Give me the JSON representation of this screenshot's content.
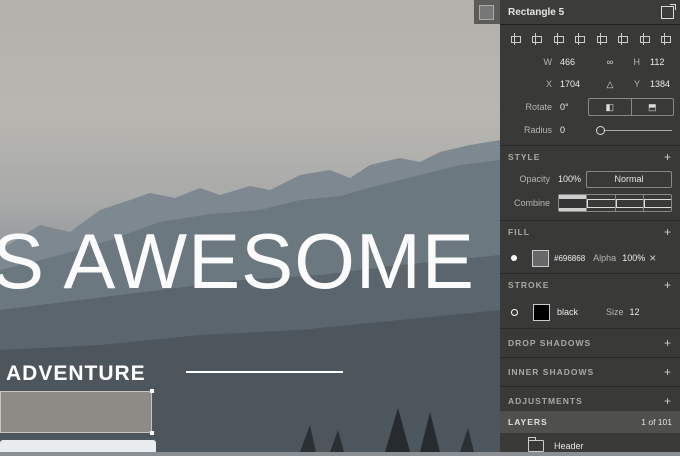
{
  "canvas": {
    "headline": "S AWESOME",
    "subheadline": "ADVENTURE"
  },
  "panel": {
    "title": "Rectangle 5",
    "w_label": "W",
    "w_value": "466",
    "h_label": "H",
    "h_value": "112",
    "x_label": "X",
    "x_value": "1704",
    "y_label": "Y",
    "y_value": "1384",
    "rotate_label": "Rotate",
    "rotate_value": "0°",
    "radius_label": "Radius",
    "radius_value": "0",
    "style_header": "STYLE",
    "opacity_label": "Opacity",
    "opacity_value": "100%",
    "blend_mode": "Normal",
    "combine_label": "Combine",
    "fill_header": "FILL",
    "fill_color_hex": "#696868",
    "fill_alpha_label": "Alpha",
    "fill_alpha_value": "100%",
    "stroke_header": "STROKE",
    "stroke_color": "black",
    "stroke_size_label": "Size",
    "stroke_size_value": "12",
    "drop_shadows_header": "DROP SHADOWS",
    "inner_shadows_header": "INNER SHADOWS",
    "adjustments_header": "ADJUSTMENTS",
    "layers_header": "LAYERS",
    "layers_count": "1 of 101",
    "layer_name": "Header"
  },
  "icons": {
    "plus": "+",
    "close": "×"
  }
}
